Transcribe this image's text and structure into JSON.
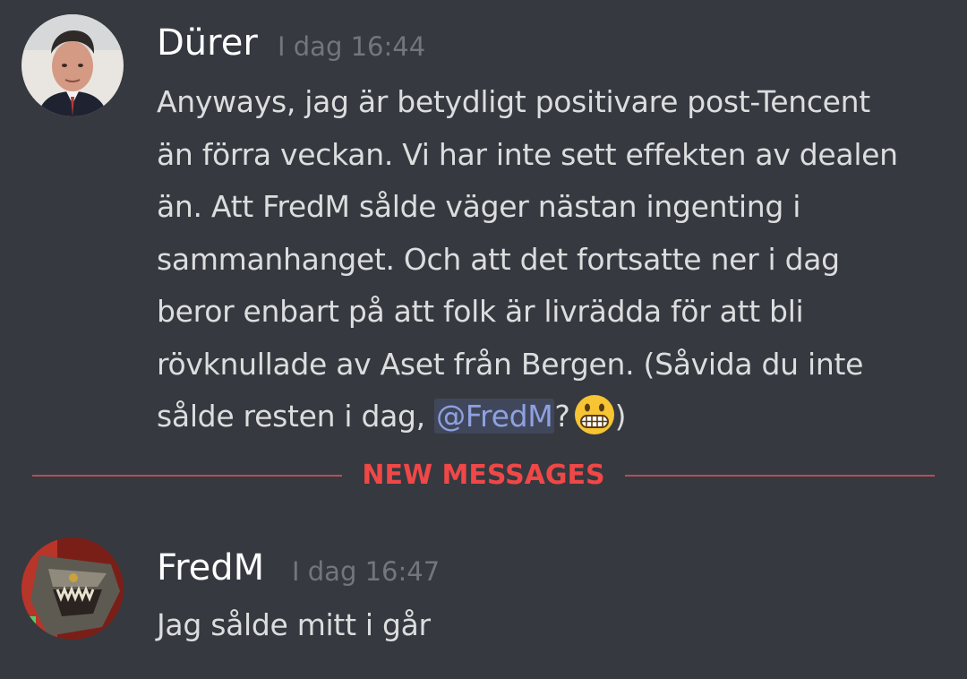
{
  "messages": [
    {
      "author": "Dürer",
      "timestamp": "I dag 16:44",
      "lines": [
        "Anyways, jag är betydligt positivare post-Tencent",
        "än förra veckan. Vi har inte sett effekten av dealen",
        "än. Att FredM sålde väger nästan ingenting i",
        "sammanhanget. Och att det fortsatte ner i dag",
        "beror enbart på att folk är livrädda för att bli",
        "rövknullade av Aset från Bergen. (Såvida du inte"
      ],
      "last_line_prefix": "sålde resten i dag, ",
      "mention": "@FredM",
      "last_line_after_mention": "?",
      "emoji": "grimacing-face-emoji",
      "last_line_suffix": ")"
    },
    {
      "author": "FredM",
      "timestamp": "I dag 16:47",
      "text": "Jag sålde mitt i går"
    }
  ],
  "divider": {
    "label": "NEW MESSAGES",
    "color": "#f04747"
  },
  "colors": {
    "background": "#36393f",
    "username": "#ffffff",
    "message_text": "#dcddde",
    "timestamp": "#72767d",
    "mention": "#8ea1e1"
  }
}
